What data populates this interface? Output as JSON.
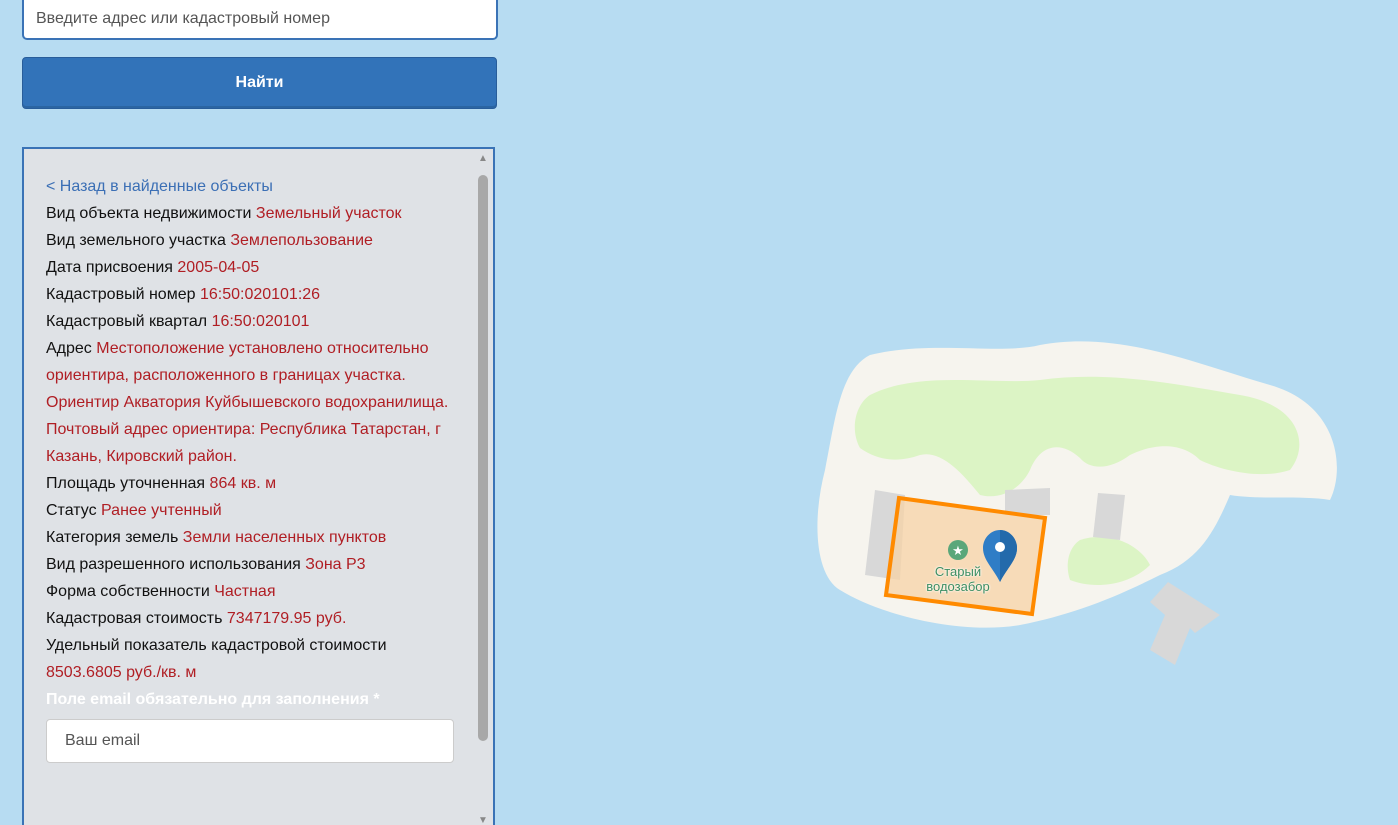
{
  "search": {
    "placeholder": "Введите адрес или кадастровый номер",
    "button_label": "Найти"
  },
  "details": {
    "back_link": "< Назад в найденные объекты",
    "fields": [
      {
        "label": "Вид объекта недвижимости",
        "value": "Земельный участок"
      },
      {
        "label": "Вид земельного участка",
        "value": "Землепользование"
      },
      {
        "label": "Дата присвоения",
        "value": "2005-04-05"
      },
      {
        "label": "Кадастровый номер",
        "value": "16:50:020101:26"
      },
      {
        "label": "Кадастровый квартал",
        "value": "16:50:020101"
      },
      {
        "label": "Адрес",
        "value": "Местоположение установлено относительно ориентира, расположенного в границах участка. Ориентир Акватория Куйбышевского водохранилища. Почтовый адрес ориентира: Республика Татарстан, г Казань, Кировский район."
      },
      {
        "label": "Площадь уточненная",
        "value": "864 кв. м"
      },
      {
        "label": "Статус",
        "value": "Ранее учтенный"
      },
      {
        "label": "Категория земель",
        "value": "Земли населенных пунктов"
      },
      {
        "label": "Вид разрешенного использования",
        "value": "Зона Р3"
      },
      {
        "label": "Форма собственности",
        "value": "Частная"
      },
      {
        "label": "Кадастровая стоимость",
        "value": "7347179.95 руб."
      },
      {
        "label": "Удельный показатель кадастровой стоимости",
        "value": "8503.6805 руб./кв. м"
      }
    ],
    "email_required": "Поле email обязательно для заполнения *",
    "email_placeholder": "Ваш email"
  },
  "map": {
    "poi_label_line1": "Старый",
    "poi_label_line2": "водозабор",
    "colors": {
      "water": "#b7dcf2",
      "land": "#f6f4ee",
      "park": "#dcf4c5",
      "building": "#d8d8d8",
      "parcel_border": "#ff8a00",
      "parcel_fill": "#f7d3a6",
      "marker": "#2f7dc6"
    }
  }
}
